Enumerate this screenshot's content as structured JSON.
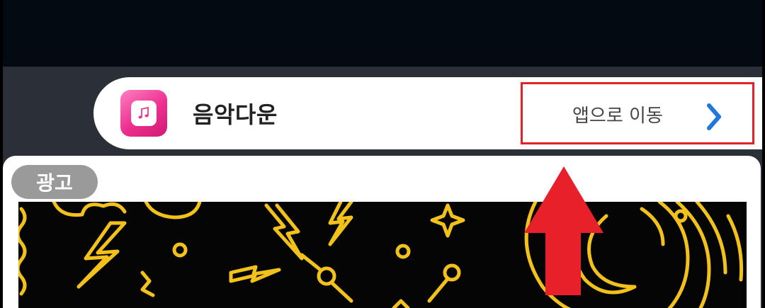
{
  "app_bar": {
    "app_name": "음악다운",
    "goto_label": "앱으로 이동",
    "icon": "music-note-icon",
    "accent_color": "#2277dd",
    "highlight_color": "#e22228"
  },
  "ad": {
    "badge_label": "광고"
  },
  "annotation": {
    "arrow_color": "#e8202a"
  }
}
